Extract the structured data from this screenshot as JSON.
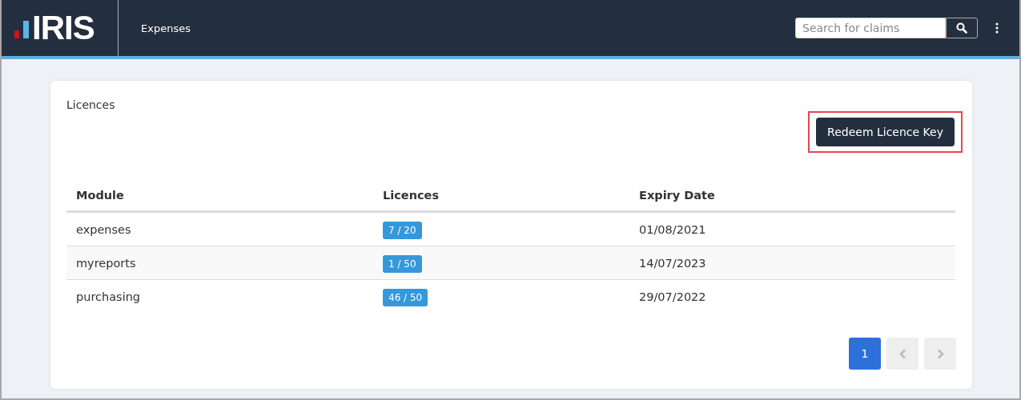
{
  "header": {
    "logo": "IRIS",
    "nav_title": "Expenses",
    "search": {
      "placeholder": "Search for claims"
    }
  },
  "card": {
    "title": "Licences",
    "redeem_button": {
      "label": "Redeem Licence Key",
      "highlighted": true
    },
    "table": {
      "columns": [
        "Module",
        "Licences",
        "Expiry Date"
      ],
      "rows": [
        {
          "module": "expenses",
          "licences": "7 / 20",
          "expiry": "01/08/2021"
        },
        {
          "module": "myreports",
          "licences": "1 / 50",
          "expiry": "14/07/2023"
        },
        {
          "module": "purchasing",
          "licences": "46 / 50",
          "expiry": "29/07/2022"
        }
      ]
    },
    "pagination": {
      "pages": [
        {
          "label": "1",
          "selected": true
        }
      ],
      "previous_disabled": true,
      "next_disabled": true
    }
  }
}
